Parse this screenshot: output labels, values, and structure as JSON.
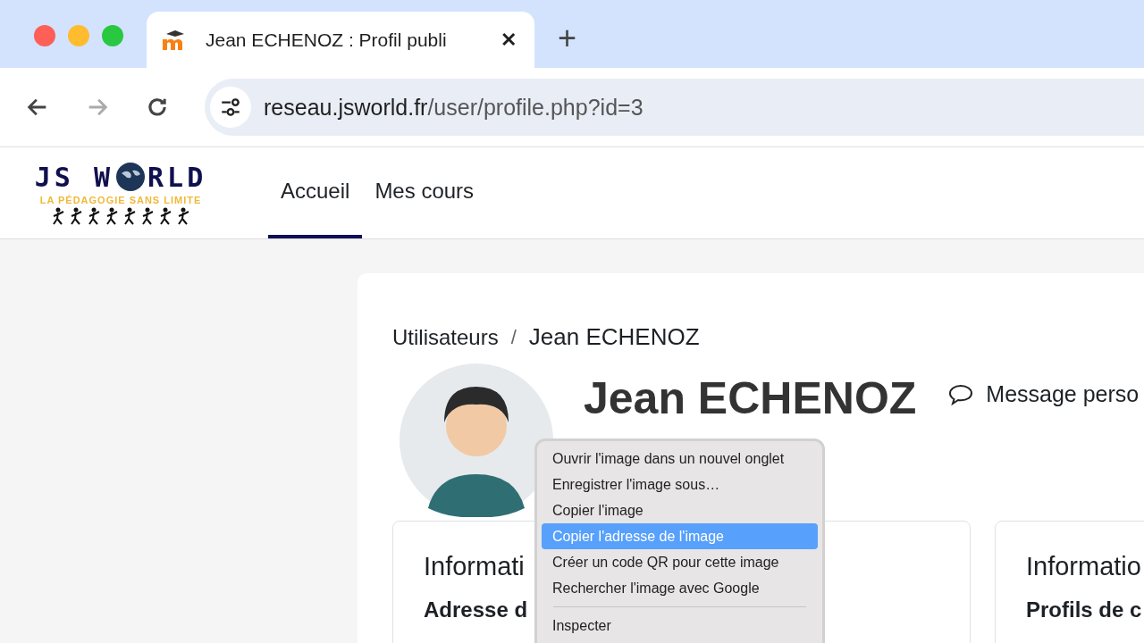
{
  "browser": {
    "tab": {
      "title": "Jean ECHENOZ  : Profil publi",
      "close": "✕"
    },
    "new_tab": "+",
    "url": {
      "domain": "reseau.jsworld.fr",
      "path": "/user/profile.php?id=3"
    }
  },
  "site": {
    "logo": {
      "left": "JS W",
      "right": "RLD",
      "tagline": "LA PÉDAGOGIE SANS LIMITE"
    },
    "nav": [
      {
        "label": "Accueil",
        "selected": true
      },
      {
        "label": "Mes cours",
        "selected": false
      }
    ]
  },
  "breadcrumb": {
    "items": [
      "Utilisateurs",
      "Jean ECHENOZ"
    ],
    "separator": "/"
  },
  "profile": {
    "name": "Jean ECHENOZ",
    "message": "Message perso"
  },
  "cards": [
    {
      "title": "Informati",
      "subtitle": "Adresse d"
    },
    {
      "title": "Informatio",
      "subtitle": "Profils de c"
    }
  ],
  "context_menu": [
    {
      "kind": "item",
      "label": "Ouvrir l'image dans un nouvel onglet",
      "selected": false
    },
    {
      "kind": "item",
      "label": "Enregistrer l'image sous…",
      "selected": false
    },
    {
      "kind": "item",
      "label": "Copier l'image",
      "selected": false
    },
    {
      "kind": "item",
      "label": "Copier l'adresse de l'image",
      "selected": true
    },
    {
      "kind": "item",
      "label": "Créer un code QR pour cette image",
      "selected": false
    },
    {
      "kind": "item",
      "label": "Rechercher l'image avec Google",
      "selected": false
    },
    {
      "kind": "separator"
    },
    {
      "kind": "item",
      "label": "Inspecter",
      "selected": false
    }
  ]
}
